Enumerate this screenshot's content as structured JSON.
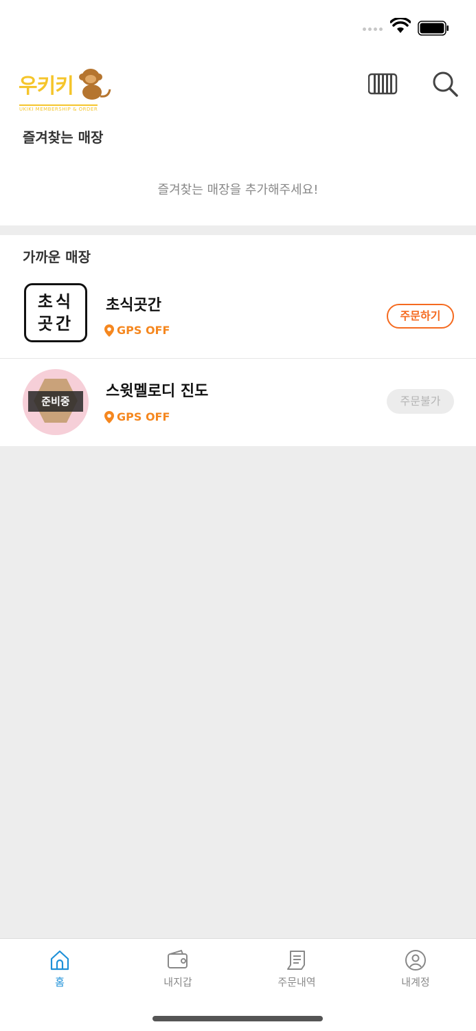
{
  "header": {
    "logo_text": "우키키",
    "logo_subtitle": "UKIKI MEMBERSHIP & ORDER"
  },
  "favorites": {
    "title": "즐겨찾는 매장",
    "empty_message": "즐겨찾는 매장을 추가해주세요!"
  },
  "nearby": {
    "title": "가까운 매장",
    "stores": [
      {
        "name": "초식곳간",
        "logo_line1": "초식",
        "logo_line2": "곳간",
        "gps": "GPS OFF",
        "button": "주문하기",
        "button_state": "active"
      },
      {
        "name": "스윗멜로디 진도",
        "badge": "준비중",
        "gps": "GPS OFF",
        "button": "주문불가",
        "button_state": "disabled"
      }
    ]
  },
  "tabs": [
    {
      "label": "홈",
      "icon": "home-icon",
      "active": true
    },
    {
      "label": "내지갑",
      "icon": "wallet-icon",
      "active": false
    },
    {
      "label": "주문내역",
      "icon": "receipt-icon",
      "active": false
    },
    {
      "label": "내계정",
      "icon": "user-icon",
      "active": false
    }
  ],
  "colors": {
    "brand_yellow": "#f5c52b",
    "accent_orange": "#f56a1f",
    "gps_orange": "#f5871f",
    "active_tab_blue": "#1e90d8"
  }
}
